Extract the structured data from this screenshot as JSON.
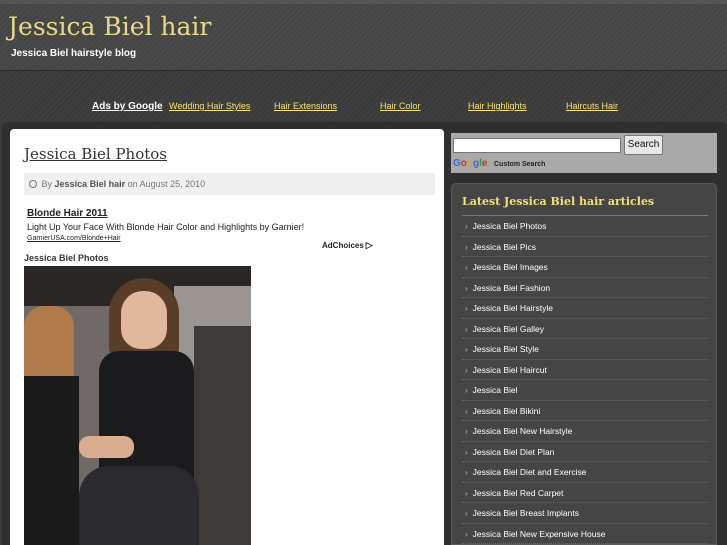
{
  "header": {
    "title": "Jessica Biel hair",
    "description": "Jessica Biel hairstyle blog"
  },
  "nav": {
    "ads_label": "Ads by Google",
    "links": [
      "Wedding Hair Styles",
      "Hair Extensions",
      "Hair Color",
      "Hair Highlights",
      "Haircuts Hair"
    ]
  },
  "post": {
    "title": "Jessica Biel Photos",
    "by_label": "By",
    "author": "Jessica Biel hair",
    "date": "on August 25, 2010",
    "ad": {
      "title": "Blonde Hair 2011",
      "text": "Light Up Your Face With Blonde Hair Color and Highlights by Garnier!",
      "url": "GarnierUSA.com/Blonde+Hair",
      "adchoices": "AdChoices"
    },
    "photo_caption": "Jessica Biel Photos"
  },
  "search": {
    "button_label": "Search",
    "google_letters": [
      "G",
      "o",
      "o",
      "g",
      "l",
      "e"
    ],
    "custom_label": "Custom Search"
  },
  "sidebar": {
    "title": "Latest Jessica Biel hair articles",
    "items": [
      "Jessica Biel Photos",
      "Jessica Biel Pics",
      "Jessica Biel Images",
      "Jessica Biel Fashion",
      "Jessica Biel Hairstyle",
      "Jessica Biel Galley",
      "Jessica Biel Style",
      "Jessica Biel Haircut",
      "Jessica Biel",
      "Jessica Biel Bikini",
      "Jessica Biel New Hairstyle",
      "Jessica Biel Diet Plan",
      "Jessica Biel Diet and Exercise",
      "Jessica Biel Red Carpet",
      "Jessica Biel Breast Implants",
      "Jessica Biel New Expensive House"
    ]
  },
  "colors": {
    "title_gold": "#e6d98a",
    "nav_link": "#f2e27a",
    "page_bg": "#3c3c3c"
  }
}
